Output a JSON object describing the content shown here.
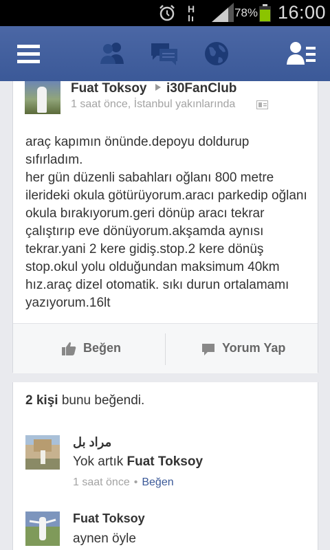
{
  "status_bar": {
    "battery_percent": "78%",
    "time": "16:00",
    "network_type": "H"
  },
  "navbar": {
    "icons": [
      "menu-icon",
      "friends-icon",
      "messages-icon",
      "notifications-globe-icon",
      "friend-requests-icon"
    ]
  },
  "post": {
    "author": "Fuat Toksoy",
    "group": "i30FanClub",
    "meta": "1 saat önce, İstanbul yakınlarında",
    "text": "araç kapımın önünde.depoyu doldurup sıfırladım.\nher gün düzenli sabahları oğlanı 800 metre ilerideki okula götürüyorum.aracı parkedip oğlanı okula bırakıyorum.geri dönüp aracı tekrar çalıştırıp eve dönüyorum.akşamda aynısı tekrar.yani 2 kere gidiş.stop.2 kere dönüş stop.okul yolu olduğundan maksimum 40km hız.araç dizel otomatik. sıkı durun ortalamamı yazıyorum.16lt",
    "like_label": "Beğen",
    "comment_label": "Yorum Yap"
  },
  "likes": {
    "count": "2 kişi",
    "suffix": " bunu beğendi."
  },
  "comments": [
    {
      "name": "مراد بل",
      "text_prefix": "Yok artık ",
      "text_mention": "Fuat Toksoy",
      "time": "1 saat önce",
      "like_label": "Beğen"
    },
    {
      "name": "Fuat Toksoy",
      "text": "aynen öyle"
    }
  ],
  "colors": {
    "facebook_blue": "#3b5998",
    "status_bar": "#000000",
    "battery_green": "#8bc400"
  }
}
